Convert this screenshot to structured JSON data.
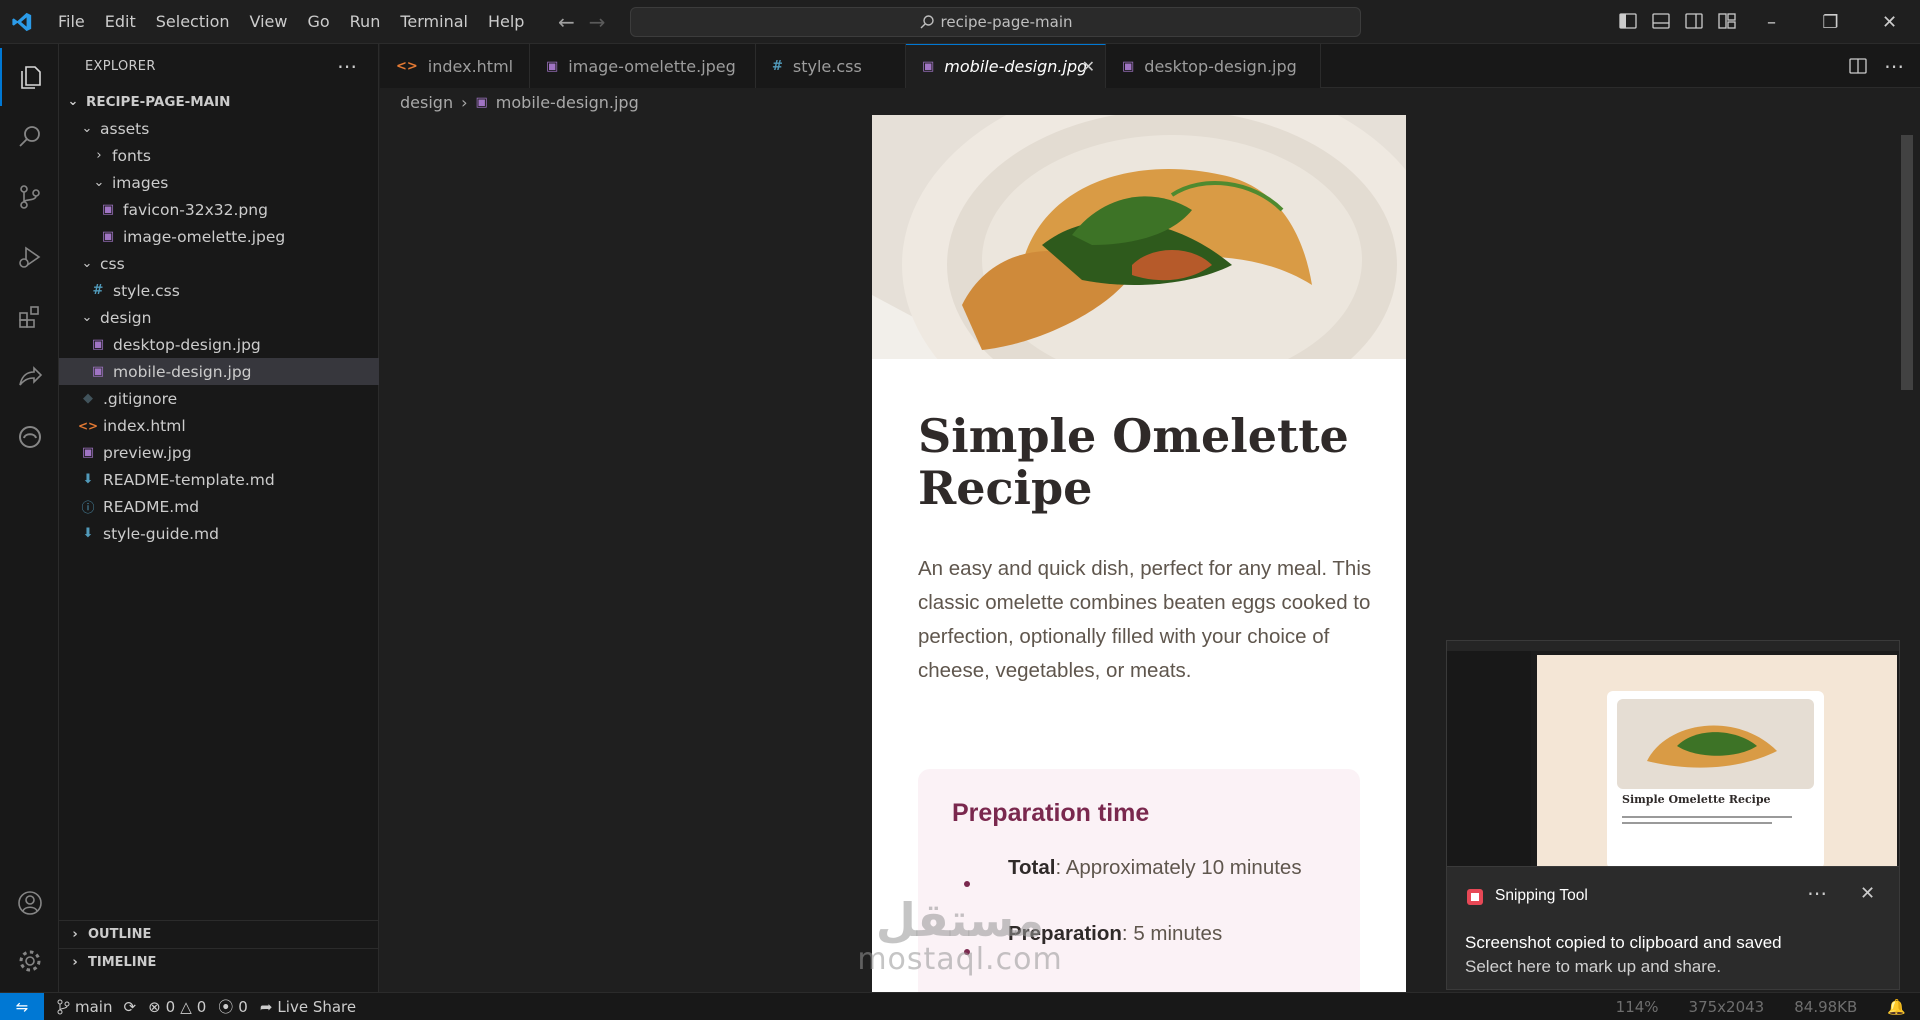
{
  "menu": [
    "File",
    "Edit",
    "Selection",
    "View",
    "Go",
    "Run",
    "Terminal",
    "Help"
  ],
  "command_center": "recipe-page-main",
  "explorer": {
    "header": "EXPLORER",
    "root": "RECIPE-PAGE-MAIN",
    "items": [
      {
        "label": "assets",
        "type": "folder",
        "open": true,
        "depth": 1
      },
      {
        "label": "fonts",
        "type": "folder",
        "open": false,
        "depth": 2
      },
      {
        "label": "images",
        "type": "folder",
        "open": true,
        "depth": 2
      },
      {
        "label": "favicon-32x32.png",
        "type": "image",
        "depth": 3
      },
      {
        "label": "image-omelette.jpeg",
        "type": "image",
        "depth": 3
      },
      {
        "label": "css",
        "type": "folder",
        "open": true,
        "depth": 1
      },
      {
        "label": "style.css",
        "type": "css",
        "depth": 2
      },
      {
        "label": "design",
        "type": "folder",
        "open": true,
        "depth": 1
      },
      {
        "label": "desktop-design.jpg",
        "type": "image",
        "depth": 2
      },
      {
        "label": "mobile-design.jpg",
        "type": "image",
        "depth": 2,
        "selected": true
      },
      {
        "label": ".gitignore",
        "type": "git",
        "depth": 1
      },
      {
        "label": "index.html",
        "type": "html",
        "depth": 1
      },
      {
        "label": "preview.jpg",
        "type": "image",
        "depth": 1
      },
      {
        "label": "README-template.md",
        "type": "md",
        "depth": 1
      },
      {
        "label": "README.md",
        "type": "info",
        "depth": 1
      },
      {
        "label": "style-guide.md",
        "type": "md",
        "depth": 1
      }
    ],
    "outline": "OUTLINE",
    "timeline": "TIMELINE"
  },
  "tabs": [
    {
      "label": "index.html",
      "type": "html"
    },
    {
      "label": "image-omelette.jpeg",
      "type": "image"
    },
    {
      "label": "style.css",
      "type": "css"
    },
    {
      "label": "mobile-design.jpg",
      "type": "image",
      "active": true
    },
    {
      "label": "desktop-design.jpg",
      "type": "image"
    }
  ],
  "breadcrumb": {
    "folder": "design",
    "file": "mobile-design.jpg"
  },
  "preview": {
    "title": "Simple Omelette Recipe",
    "description": "An easy and quick dish, perfect for any meal. This classic omelette combines beaten eggs cooked to perfection, optionally filled with your choice of cheese, vegetables, or meats.",
    "prep_title": "Preparation time",
    "prep_items": [
      {
        "label": "Total",
        "value": ": Approximately 10 minutes"
      },
      {
        "label": "Preparation",
        "value": ": 5 minutes"
      }
    ]
  },
  "watermark": {
    "arabic": "مستقل",
    "latin": "mostaql.com"
  },
  "toast": {
    "app": "Snipping Tool",
    "headline": "Screenshot copied to clipboard and saved",
    "sub": "Select here to mark up and share."
  },
  "snip_preview_title": "Simple Omelette Recipe",
  "status": {
    "branch": "main",
    "errors": "0",
    "warnings": "0",
    "ports": "0",
    "live_share": "Live Share",
    "zoom": "114%",
    "dimensions": "375x2043",
    "size": "84.98KB"
  },
  "colors": {
    "accent": "#0078d4",
    "recipe_brown": "#7a284e",
    "prep_bg": "#fbf2f6"
  }
}
